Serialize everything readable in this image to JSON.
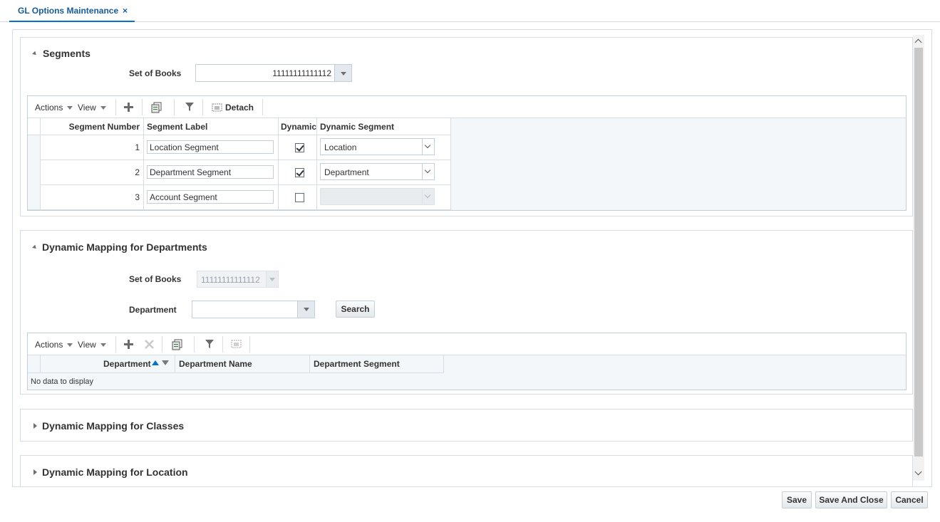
{
  "tab": {
    "label": "GL Options Maintenance",
    "close": "×"
  },
  "segments": {
    "title": "Segments",
    "set_of_books_label": "Set of Books",
    "set_of_books_value": "11111111111112",
    "toolbar": {
      "actions": "Actions",
      "view": "View",
      "detach": "Detach"
    },
    "columns": [
      "Segment Number",
      "Segment Label",
      "Dynamic",
      "Dynamic Segment"
    ],
    "rows": [
      {
        "number": "1",
        "label": "Location Segment",
        "dynamic": true,
        "dynamic_segment": "Location"
      },
      {
        "number": "2",
        "label": "Department Segment",
        "dynamic": true,
        "dynamic_segment": "Department"
      },
      {
        "number": "3",
        "label": "Account Segment",
        "dynamic": false,
        "dynamic_segment": ""
      }
    ]
  },
  "dept_mapping": {
    "title": "Dynamic Mapping for Departments",
    "set_of_books_label": "Set of Books",
    "set_of_books_value": "11111111111112",
    "department_label": "Department",
    "department_value": "",
    "search_button": "Search",
    "toolbar": {
      "actions": "Actions",
      "view": "View"
    },
    "columns": [
      "Department",
      "Department Name",
      "Department Segment"
    ],
    "empty_text": "No data to display"
  },
  "class_mapping": {
    "title": "Dynamic Mapping for Classes"
  },
  "location_mapping": {
    "title": "Dynamic Mapping for Location"
  },
  "footer": {
    "save": "Save",
    "save_and_close": "Save And Close",
    "cancel": "Cancel"
  }
}
